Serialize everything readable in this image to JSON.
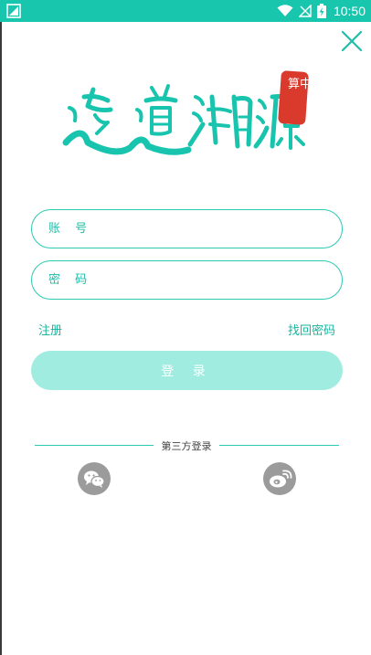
{
  "status_bar": {
    "time": "10:50",
    "background": "#17c6ad"
  },
  "logo": {
    "main_text": "逐道溯源",
    "seal_text": "算中體",
    "alt": "逐道溯源"
  },
  "form": {
    "account_placeholder": "账 号",
    "password_placeholder": "密 码",
    "register_label": "注册",
    "forgot_label": "找回密码",
    "login_label": "登 录"
  },
  "third_party": {
    "label": "第三方登录",
    "icons": [
      "wechat-icon",
      "weibo-icon"
    ]
  },
  "colors": {
    "accent": "#2cc9b3",
    "button_disabled": "#a0ece0",
    "social_icon_bg": "#9b9b9b"
  }
}
